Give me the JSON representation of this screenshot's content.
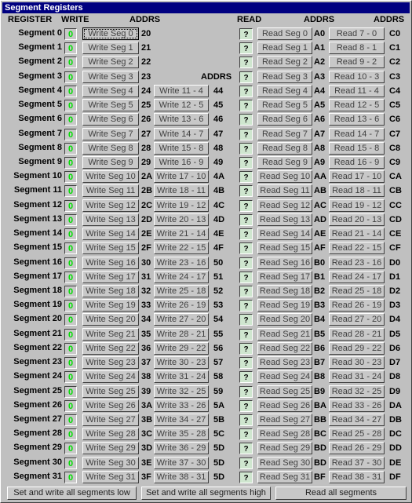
{
  "window": {
    "title": "Segment Registers"
  },
  "headers": {
    "register": "REGISTER",
    "write": "WRITE",
    "addrs1": "ADDRS",
    "addrs2": "ADDRS",
    "read": "READ",
    "addrs3": "ADDRS",
    "addrs4": "ADDRS"
  },
  "colors": {
    "title_bg": "#000080",
    "value_text": "#00dd00",
    "read_box_bg": "#cfe6cf",
    "panel_bg": "#c0c0c0"
  },
  "rows": [
    {
      "label": "Segment 0",
      "value": "0",
      "write": "Write Seg 0",
      "waddr": "20",
      "pair_write": null,
      "paddr": null,
      "read_value": "?",
      "read": "Read Seg 0",
      "raddr": "A0",
      "pair_read": "Read 7 - 0",
      "praddr": "C0"
    },
    {
      "label": "Segment 1",
      "value": "0",
      "write": "Write Seg 1",
      "waddr": "21",
      "pair_write": null,
      "paddr": null,
      "read_value": "?",
      "read": "Read Seg 1",
      "raddr": "A1",
      "pair_read": "Read 8 - 1",
      "praddr": "C1"
    },
    {
      "label": "Segment 2",
      "value": "0",
      "write": "Write Seg 2",
      "waddr": "22",
      "pair_write": null,
      "paddr": null,
      "read_value": "?",
      "read": "Read Seg 2",
      "raddr": "A2",
      "pair_read": "Read 9 - 2",
      "praddr": "C2"
    },
    {
      "label": "Segment 3",
      "value": "0",
      "write": "Write Seg 3",
      "waddr": "23",
      "pair_write": null,
      "paddr": null,
      "read_value": "?",
      "read": "Read Seg 3",
      "raddr": "A3",
      "pair_read": "Read 10 - 3",
      "praddr": "C3"
    },
    {
      "label": "Segment 4",
      "value": "0",
      "write": "Write Seg 4",
      "waddr": "24",
      "pair_write": "Write 11 - 4",
      "paddr": "44",
      "read_value": "?",
      "read": "Read Seg 4",
      "raddr": "A4",
      "pair_read": "Read 11 - 4",
      "praddr": "C4"
    },
    {
      "label": "Segment 5",
      "value": "0",
      "write": "Write Seg 5",
      "waddr": "25",
      "pair_write": "Write 12 - 5",
      "paddr": "45",
      "read_value": "?",
      "read": "Read Seg 5",
      "raddr": "A5",
      "pair_read": "Read 12 - 5",
      "praddr": "C5"
    },
    {
      "label": "Segment 6",
      "value": "0",
      "write": "Write Seg 6",
      "waddr": "26",
      "pair_write": "Write 13 - 6",
      "paddr": "46",
      "read_value": "?",
      "read": "Read Seg 6",
      "raddr": "A6",
      "pair_read": "Read 13 - 6",
      "praddr": "C6"
    },
    {
      "label": "Segment 7",
      "value": "0",
      "write": "Write Seg 7",
      "waddr": "27",
      "pair_write": "Write 14 - 7",
      "paddr": "47",
      "read_value": "?",
      "read": "Read Seg 7",
      "raddr": "A7",
      "pair_read": "Read 14 - 7",
      "praddr": "C7"
    },
    {
      "label": "Segment 8",
      "value": "0",
      "write": "Write Seg 8",
      "waddr": "28",
      "pair_write": "Write 15 - 8",
      "paddr": "48",
      "read_value": "?",
      "read": "Read Seg 8",
      "raddr": "A8",
      "pair_read": "Read 15 - 8",
      "praddr": "C8"
    },
    {
      "label": "Segment 9",
      "value": "0",
      "write": "Write Seg 9",
      "waddr": "29",
      "pair_write": "Write 16 - 9",
      "paddr": "49",
      "read_value": "?",
      "read": "Read Seg 9",
      "raddr": "A9",
      "pair_read": "Read 16 - 9",
      "praddr": "C9"
    },
    {
      "label": "Segment 10",
      "value": "0",
      "write": "Write Seg 10",
      "waddr": "2A",
      "pair_write": "Write 17 - 10",
      "paddr": "4A",
      "read_value": "?",
      "read": "Read Seg 10",
      "raddr": "AA",
      "pair_read": "Read 17 - 10",
      "praddr": "CA"
    },
    {
      "label": "Segment 11",
      "value": "0",
      "write": "Write Seg 11",
      "waddr": "2B",
      "pair_write": "Write 18 - 11",
      "paddr": "4B",
      "read_value": "?",
      "read": "Read Seg 11",
      "raddr": "AB",
      "pair_read": "Read 18 - 11",
      "praddr": "CB"
    },
    {
      "label": "Segment 12",
      "value": "0",
      "write": "Write Seg 12",
      "waddr": "2C",
      "pair_write": "Write 19 - 12",
      "paddr": "4C",
      "read_value": "?",
      "read": "Read Seg 12",
      "raddr": "AC",
      "pair_read": "Read 19 - 12",
      "praddr": "CC"
    },
    {
      "label": "Segment 13",
      "value": "0",
      "write": "Write Seg 13",
      "waddr": "2D",
      "pair_write": "Write 20 - 13",
      "paddr": "4D",
      "read_value": "?",
      "read": "Read Seg 13",
      "raddr": "AD",
      "pair_read": "Read 20 - 13",
      "praddr": "CD"
    },
    {
      "label": "Segment 14",
      "value": "0",
      "write": "Write Seg 14",
      "waddr": "2E",
      "pair_write": "Write 21 - 14",
      "paddr": "4E",
      "read_value": "?",
      "read": "Read Seg 14",
      "raddr": "AE",
      "pair_read": "Read 21 - 14",
      "praddr": "CE"
    },
    {
      "label": "Segment 15",
      "value": "0",
      "write": "Write Seg 15",
      "waddr": "2F",
      "pair_write": "Write 22 - 15",
      "paddr": "4F",
      "read_value": "?",
      "read": "Read Seg 15",
      "raddr": "AF",
      "pair_read": "Read 22 - 15",
      "praddr": "CF"
    },
    {
      "label": "Segment 16",
      "value": "0",
      "write": "Write Seg 16",
      "waddr": "30",
      "pair_write": "Write 23 - 16",
      "paddr": "50",
      "read_value": "?",
      "read": "Read Seg 16",
      "raddr": "B0",
      "pair_read": "Read 23 - 16",
      "praddr": "D0"
    },
    {
      "label": "Segment 17",
      "value": "0",
      "write": "Write Seg 17",
      "waddr": "31",
      "pair_write": "Write 24 - 17",
      "paddr": "51",
      "read_value": "?",
      "read": "Read Seg 17",
      "raddr": "B1",
      "pair_read": "Read 24 - 17",
      "praddr": "D1"
    },
    {
      "label": "Segment 18",
      "value": "0",
      "write": "Write Seg 18",
      "waddr": "32",
      "pair_write": "Write 25 - 18",
      "paddr": "52",
      "read_value": "?",
      "read": "Read Seg 18",
      "raddr": "B2",
      "pair_read": "Read 25 - 18",
      "praddr": "D2"
    },
    {
      "label": "Segment 19",
      "value": "0",
      "write": "Write Seg 19",
      "waddr": "33",
      "pair_write": "Write 26 - 19",
      "paddr": "53",
      "read_value": "?",
      "read": "Read Seg 19",
      "raddr": "B3",
      "pair_read": "Read 26 - 19",
      "praddr": "D3"
    },
    {
      "label": "Segment 20",
      "value": "0",
      "write": "Write Seg 20",
      "waddr": "34",
      "pair_write": "Write 27 - 20",
      "paddr": "54",
      "read_value": "?",
      "read": "Read Seg 20",
      "raddr": "B4",
      "pair_read": "Read 27 - 20",
      "praddr": "D4"
    },
    {
      "label": "Segment 21",
      "value": "0",
      "write": "Write Seg 21",
      "waddr": "35",
      "pair_write": "Write 28 - 21",
      "paddr": "55",
      "read_value": "?",
      "read": "Read Seg 21",
      "raddr": "B5",
      "pair_read": "Read 28 - 21",
      "praddr": "D5"
    },
    {
      "label": "Segment 22",
      "value": "0",
      "write": "Write Seg 22",
      "waddr": "36",
      "pair_write": "Write 29 - 22",
      "paddr": "56",
      "read_value": "?",
      "read": "Read Seg 22",
      "raddr": "B6",
      "pair_read": "Read 29 - 22",
      "praddr": "D6"
    },
    {
      "label": "Segment 23",
      "value": "0",
      "write": "Write Seg 23",
      "waddr": "37",
      "pair_write": "Write 30 - 23",
      "paddr": "57",
      "read_value": "?",
      "read": "Read Seg 23",
      "raddr": "B7",
      "pair_read": "Read 30 - 23",
      "praddr": "D7"
    },
    {
      "label": "Segment 24",
      "value": "0",
      "write": "Write Seg 24",
      "waddr": "38",
      "pair_write": "Write 31 - 24",
      "paddr": "58",
      "read_value": "?",
      "read": "Read Seg 24",
      "raddr": "B8",
      "pair_read": "Read 31 - 24",
      "praddr": "D8"
    },
    {
      "label": "Segment 25",
      "value": "0",
      "write": "Write Seg 25",
      "waddr": "39",
      "pair_write": "Write 32 - 25",
      "paddr": "59",
      "read_value": "?",
      "read": "Read Seg 25",
      "raddr": "B9",
      "pair_read": "Read 32 - 25",
      "praddr": "D9"
    },
    {
      "label": "Segment 26",
      "value": "0",
      "write": "Write Seg 26",
      "waddr": "3A",
      "pair_write": "Write 33 - 26",
      "paddr": "5A",
      "read_value": "?",
      "read": "Read Seg 26",
      "raddr": "BA",
      "pair_read": "Read 33 - 26",
      "praddr": "DA"
    },
    {
      "label": "Segment 27",
      "value": "0",
      "write": "Write Seg 27",
      "waddr": "3B",
      "pair_write": "Write 34 - 27",
      "paddr": "5B",
      "read_value": "?",
      "read": "Read Seg 27",
      "raddr": "BB",
      "pair_read": "Read 34 - 27",
      "praddr": "DB"
    },
    {
      "label": "Segment 28",
      "value": "0",
      "write": "Write Seg 28",
      "waddr": "3C",
      "pair_write": "Write 35 - 28",
      "paddr": "5C",
      "read_value": "?",
      "read": "Read Seg 28",
      "raddr": "BC",
      "pair_read": "Read 25 - 28",
      "praddr": "DC"
    },
    {
      "label": "Segment 29",
      "value": "0",
      "write": "Write Seg 29",
      "waddr": "3D",
      "pair_write": "Write 36 - 29",
      "paddr": "5D",
      "read_value": "?",
      "read": "Read Seg 29",
      "raddr": "BD",
      "pair_read": "Read 26 - 29",
      "praddr": "DD"
    },
    {
      "label": "Segment 30",
      "value": "0",
      "write": "Write Seg 30",
      "waddr": "3E",
      "pair_write": "Write 37 - 30",
      "paddr": "5D",
      "read_value": "?",
      "read": "Read Seg 30",
      "raddr": "BD",
      "pair_read": "Read 37 - 30",
      "praddr": "DE"
    },
    {
      "label": "Segment 31",
      "value": "0",
      "write": "Write Seg 31",
      "waddr": "3F",
      "pair_write": "Write 38 - 31",
      "paddr": "5D",
      "read_value": "?",
      "read": "Read Seg 31",
      "raddr": "BF",
      "pair_read": "Read 38 - 31",
      "praddr": "DF"
    }
  ],
  "footer": {
    "set_low": "Set and write all segments low",
    "set_high": "Set and write all segments high",
    "read_all": "Read all segments"
  }
}
